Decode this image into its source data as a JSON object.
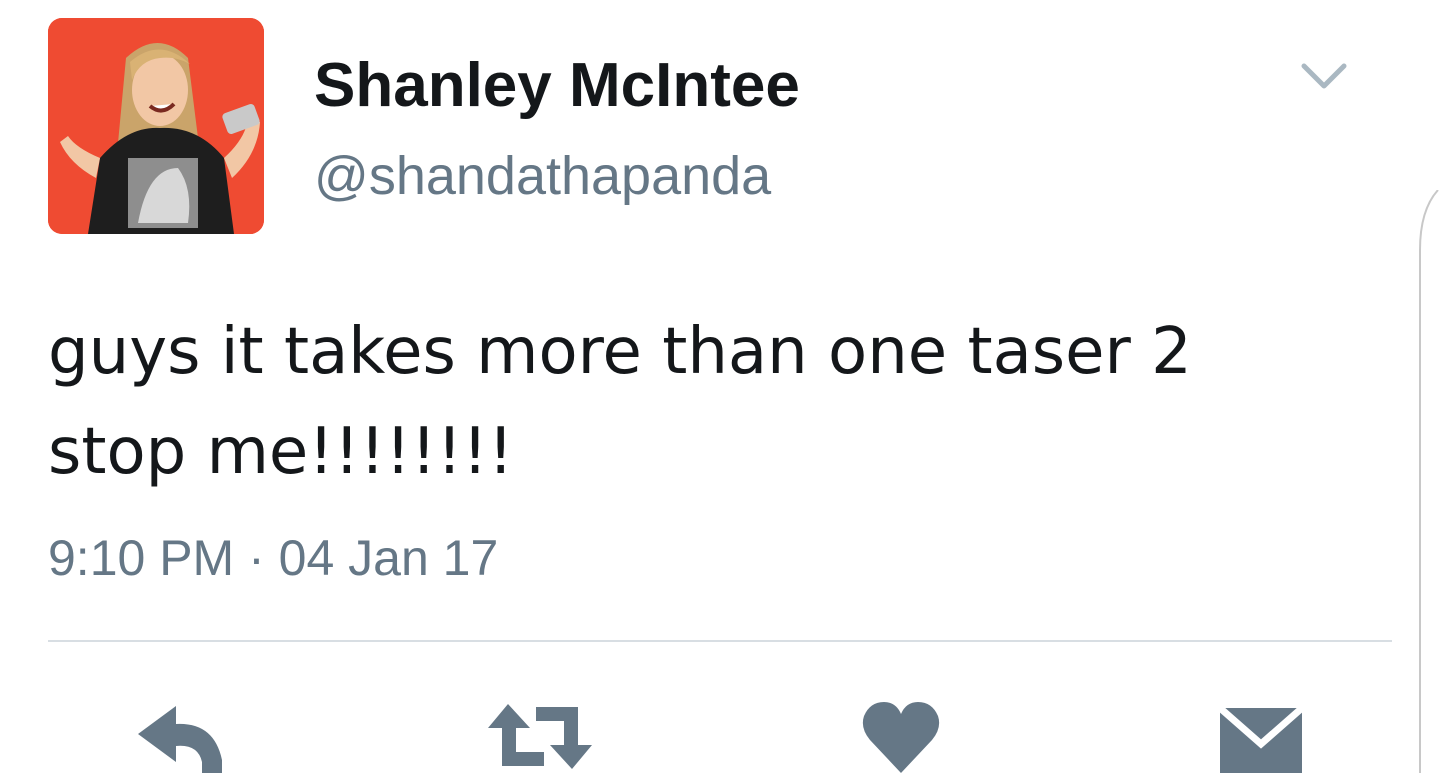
{
  "user": {
    "display_name": "Shanley McIntee",
    "handle": "@shandathapanda",
    "avatar_icon": "profile-photo"
  },
  "tweet": {
    "text": "guys it takes more than one taser 2 stop me!!!!!!!!",
    "timestamp": "9:10 PM · 04 Jan 17"
  },
  "actions": [
    {
      "name": "reply",
      "icon": "reply-icon"
    },
    {
      "name": "retweet",
      "icon": "retweet-icon"
    },
    {
      "name": "like",
      "icon": "heart-icon"
    },
    {
      "name": "direct-message",
      "icon": "envelope-icon"
    }
  ],
  "colors": {
    "name_text": "#14171a",
    "secondary_text": "#657786",
    "icon": "#657786",
    "divider": "#d8dee3",
    "avatar_bg": "#ef4b32"
  }
}
